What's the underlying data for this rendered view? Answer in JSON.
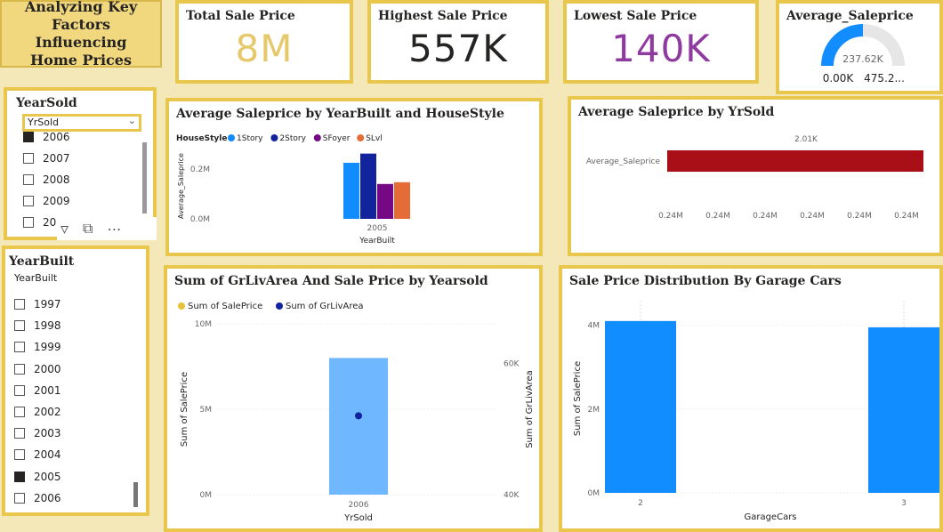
{
  "report": {
    "title": "Analyzing Key Factors Influencing Home Prices"
  },
  "kpis": {
    "total": {
      "title": "Total Sale Price",
      "value": "8M",
      "color": "#e6c86a"
    },
    "highest": {
      "title": "Highest Sale Price",
      "value": "557K",
      "color": "#252423"
    },
    "lowest": {
      "title": "Lowest Sale Price",
      "value": "140K",
      "color": "#8e3a9e"
    }
  },
  "gauge": {
    "title": "Average_Saleprice",
    "value_label": "237.62K",
    "min_label": "0.00K",
    "max_label": "475.2...",
    "fill_fraction": 0.5,
    "fill_color": "#118dff",
    "track_color": "#e6e6e6"
  },
  "slicer_yearsold": {
    "title": "YearSold",
    "dropdown_value": "YrSold",
    "items": [
      {
        "label": "2006",
        "checked": true
      },
      {
        "label": "2007",
        "checked": false
      },
      {
        "label": "2008",
        "checked": false
      },
      {
        "label": "2009",
        "checked": false
      },
      {
        "label": "201",
        "checked": false
      }
    ]
  },
  "slicer_yearbuilt": {
    "title": "YearBuilt",
    "field": "YearBuilt",
    "items": [
      {
        "label": "1997",
        "checked": false
      },
      {
        "label": "1998",
        "checked": false
      },
      {
        "label": "1999",
        "checked": false
      },
      {
        "label": "2000",
        "checked": false
      },
      {
        "label": "2001",
        "checked": false
      },
      {
        "label": "2002",
        "checked": false
      },
      {
        "label": "2003",
        "checked": false
      },
      {
        "label": "2004",
        "checked": false
      },
      {
        "label": "2005",
        "checked": true
      },
      {
        "label": "2006",
        "checked": false
      }
    ]
  },
  "chart_data": [
    {
      "type": "bar",
      "title": "Average Saleprice by YearBuilt and HouseStyle",
      "legend_title": "HouseStyle",
      "legend_position": "top-left",
      "categories": [
        "2005"
      ],
      "series": [
        {
          "name": "1Story",
          "values": [
            225000
          ],
          "color": "#118dff"
        },
        {
          "name": "2Story",
          "values": [
            262000
          ],
          "color": "#12239e"
        },
        {
          "name": "SFoyer",
          "values": [
            140000
          ],
          "color": "#750985"
        },
        {
          "name": "SLvl",
          "values": [
            147000
          ],
          "color": "#e66c37"
        }
      ],
      "xlabel": "YearBuilt",
      "ylabel": "Average_Saleprice",
      "yticks": [
        "0.0M",
        "0.2M"
      ],
      "ylim": [
        0,
        0.3
      ],
      "grid": false
    },
    {
      "type": "bar",
      "orientation": "horizontal",
      "title": "Average Saleprice by YrSold",
      "categories": [
        "Average_Saleprice"
      ],
      "values": [
        2010
      ],
      "data_label": "2.01K",
      "xticks": [
        "0.24M",
        "0.24M",
        "0.24M",
        "0.24M",
        "0.24M",
        "0.24M"
      ],
      "color": "#a80f17"
    },
    {
      "type": "bar",
      "title": "Sum of GrLivArea And Sale Price by Yearsold",
      "legend_position": "top-left",
      "categories": [
        "2006"
      ],
      "series": [
        {
          "name": "Sum of SalePrice",
          "values": [
            8000000
          ],
          "color": "#6fb8ff",
          "legend_color": "#e6c13a"
        },
        {
          "name": "Sum of GrLivArea",
          "values": [
            52000
          ],
          "color": "#12239e",
          "axis": "right",
          "kind": "point"
        }
      ],
      "xlabel": "YrSold",
      "ylabel": "Sum of SalePrice",
      "y2label": "Sum of GrLivArea",
      "yticks": [
        "0M",
        "5M",
        "10M"
      ],
      "ylim": [
        0,
        10000000
      ],
      "y2ticks": [
        "40K",
        "60K"
      ],
      "y2lim": [
        40000,
        66000
      ]
    },
    {
      "type": "bar",
      "title": "Sale Price Distribution By Garage Cars",
      "categories": [
        "2",
        "3"
      ],
      "values": [
        4100000,
        3950000
      ],
      "color": "#118dff",
      "xlabel": "GarageCars",
      "ylabel": "Sum of SalePrice",
      "yticks": [
        "0M",
        "2M",
        "4M"
      ],
      "ylim": [
        0,
        4500000
      ]
    }
  ]
}
